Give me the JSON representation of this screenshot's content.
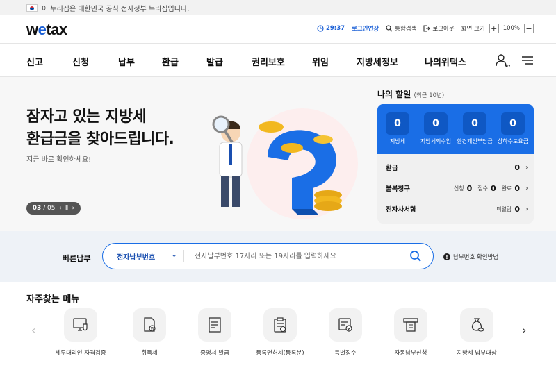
{
  "gov_bar": {
    "text": "이 누리집은 대한민국 공식 전자정부 누리집입니다."
  },
  "header": {
    "logo_pre": "w",
    "logo_e": "e",
    "logo_post": "tax",
    "timer": "29:37",
    "extend_login": "로그인연장",
    "search": "통합검색",
    "logout": "로그아웃",
    "screen_size": "화면 크기",
    "zoom_plus": "+",
    "zoom_value": "100%",
    "zoom_minus": "−"
  },
  "nav": {
    "items": [
      "신고",
      "신청",
      "납부",
      "환급",
      "발급",
      "권리보호",
      "위임",
      "지방세정보",
      "나의위택스"
    ],
    "my_label": "MY"
  },
  "hero": {
    "title_line1": "잠자고 있는 지방세",
    "title_line2": "환급금을 찾아드립니다.",
    "subtitle": "지금 바로 확인하세요!",
    "pager_current": "03",
    "pager_total": "/ 05"
  },
  "my_todo": {
    "title": "나의 할일",
    "period": "(최근 10년)",
    "counters": [
      {
        "label": "지방세",
        "value": "0"
      },
      {
        "label": "지방세외수입",
        "value": "0"
      },
      {
        "label": "환경개선부담금",
        "value": "0"
      },
      {
        "label": "상하수도요금",
        "value": "0"
      }
    ],
    "refund": {
      "label": "환급",
      "value": "0"
    },
    "appeal": {
      "label": "불복청구",
      "apply_label": "신청",
      "apply_value": "0",
      "accept_label": "접수",
      "accept_value": "0",
      "done_label": "완료",
      "done_value": "0"
    },
    "notice": {
      "label": "전자사서함",
      "unread_label": "미열람",
      "unread_value": "0"
    }
  },
  "quick_pay": {
    "label": "빠른납부",
    "select_value": "전자납부번호",
    "placeholder": "전자납부번호 17자리 또는 19자리를 입력하세요",
    "help": "납부번호 확인방법"
  },
  "favorites": {
    "title": "자주찾는 메뉴",
    "items": [
      {
        "label": "세무대리인 자격검증",
        "icon": "monitor-shield-icon"
      },
      {
        "label": "취득세",
        "icon": "document-won-icon"
      },
      {
        "label": "증명서 발급",
        "icon": "certificate-icon"
      },
      {
        "label": "등록면허세(등록분)",
        "icon": "clipboard-won-icon"
      },
      {
        "label": "특별징수",
        "icon": "calculator-check-icon"
      },
      {
        "label": "자동납부신청",
        "icon": "atm-icon"
      },
      {
        "label": "지방세 납부대상",
        "icon": "money-bag-icon"
      }
    ]
  },
  "colors": {
    "primary": "#1a6ee6",
    "dark_blue": "#0f58c4",
    "text": "#222222"
  }
}
